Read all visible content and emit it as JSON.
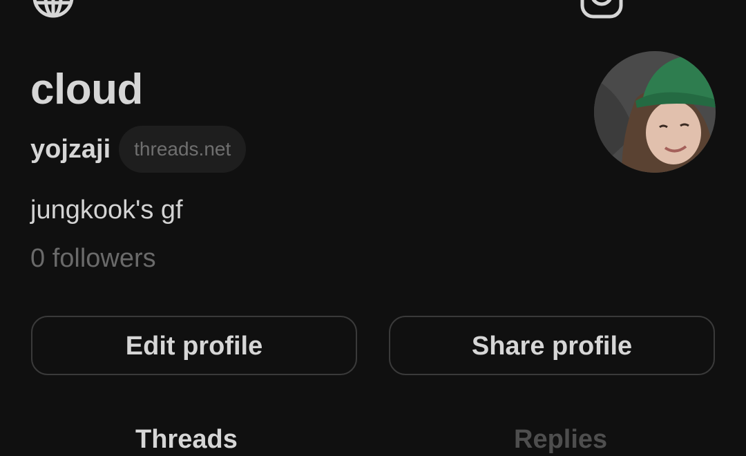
{
  "profile": {
    "display_name": "cloud",
    "username": "yojzaji",
    "domain_badge": "threads.net",
    "bio": "jungkook's gf",
    "followers": "0 followers"
  },
  "actions": {
    "edit_label": "Edit profile",
    "share_label": "Share profile"
  },
  "tabs": [
    {
      "label": "Threads",
      "active": true
    },
    {
      "label": "Replies",
      "active": false
    }
  ],
  "icons": {
    "top_left": "globe-icon",
    "top_right_1": "instagram-icon",
    "top_right_2": "menu-icon"
  },
  "colors": {
    "background": "#101010",
    "primary_text": "#d6d6d6",
    "muted_text": "#6a6a6a",
    "badge_bg": "#1e1e1e",
    "button_border": "#3a3a3a",
    "avatar_cap": "#2e7d4f"
  }
}
